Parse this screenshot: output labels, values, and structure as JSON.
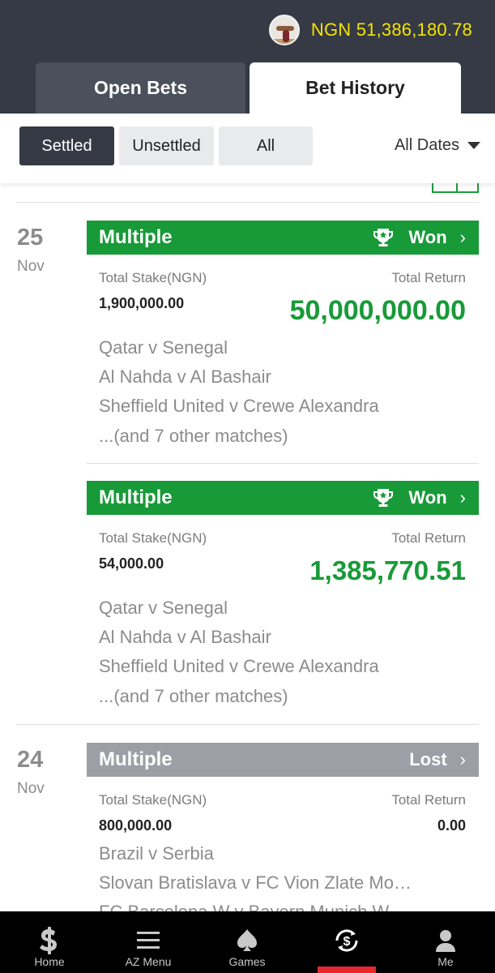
{
  "header": {
    "balance": "NGN 51,386,180.78",
    "tabs": {
      "open_bets": "Open Bets",
      "bet_history": "Bet History"
    }
  },
  "filters": {
    "settled": "Settled",
    "unsettled": "Unsettled",
    "all": "All",
    "dates": "All Dates"
  },
  "bets": [
    {
      "day": "25",
      "month": "Nov",
      "type": "Multiple",
      "status": "Won",
      "stake_label": "Total Stake(NGN)",
      "stake": "1,900,000.00",
      "return_label": "Total Return",
      "return": "50,000,000.00",
      "matches": [
        "Qatar v Senegal",
        "Al Nahda v Al Bashair",
        "Sheffield United v Crewe Alexandra",
        "...(and 7 other matches)"
      ]
    },
    {
      "type": "Multiple",
      "status": "Won",
      "stake_label": "Total Stake(NGN)",
      "stake": "54,000.00",
      "return_label": "Total Return",
      "return": "1,385,770.51",
      "matches": [
        "Qatar v Senegal",
        "Al Nahda v Al Bashair",
        "Sheffield United v Crewe Alexandra",
        "...(and 7 other matches)"
      ]
    },
    {
      "day": "24",
      "month": "Nov",
      "type": "Multiple",
      "status": "Lost",
      "stake_label": "Total Stake(NGN)",
      "stake": "800,000.00",
      "return_label": "Total Return",
      "return": "0.00",
      "matches": [
        "Brazil v Serbia",
        "Slovan Bratislava v FC Vion Zlate Mo…",
        "FC Barcelona W v Bayern Munich W"
      ]
    }
  ],
  "nav": [
    "Home",
    "AZ Menu",
    "Games",
    "",
    "Me"
  ],
  "colors": {
    "won": "#189a38",
    "lost": "#9c9fa6",
    "header": "#353a45",
    "balance": "#f5e400",
    "active": "#e8262d"
  }
}
